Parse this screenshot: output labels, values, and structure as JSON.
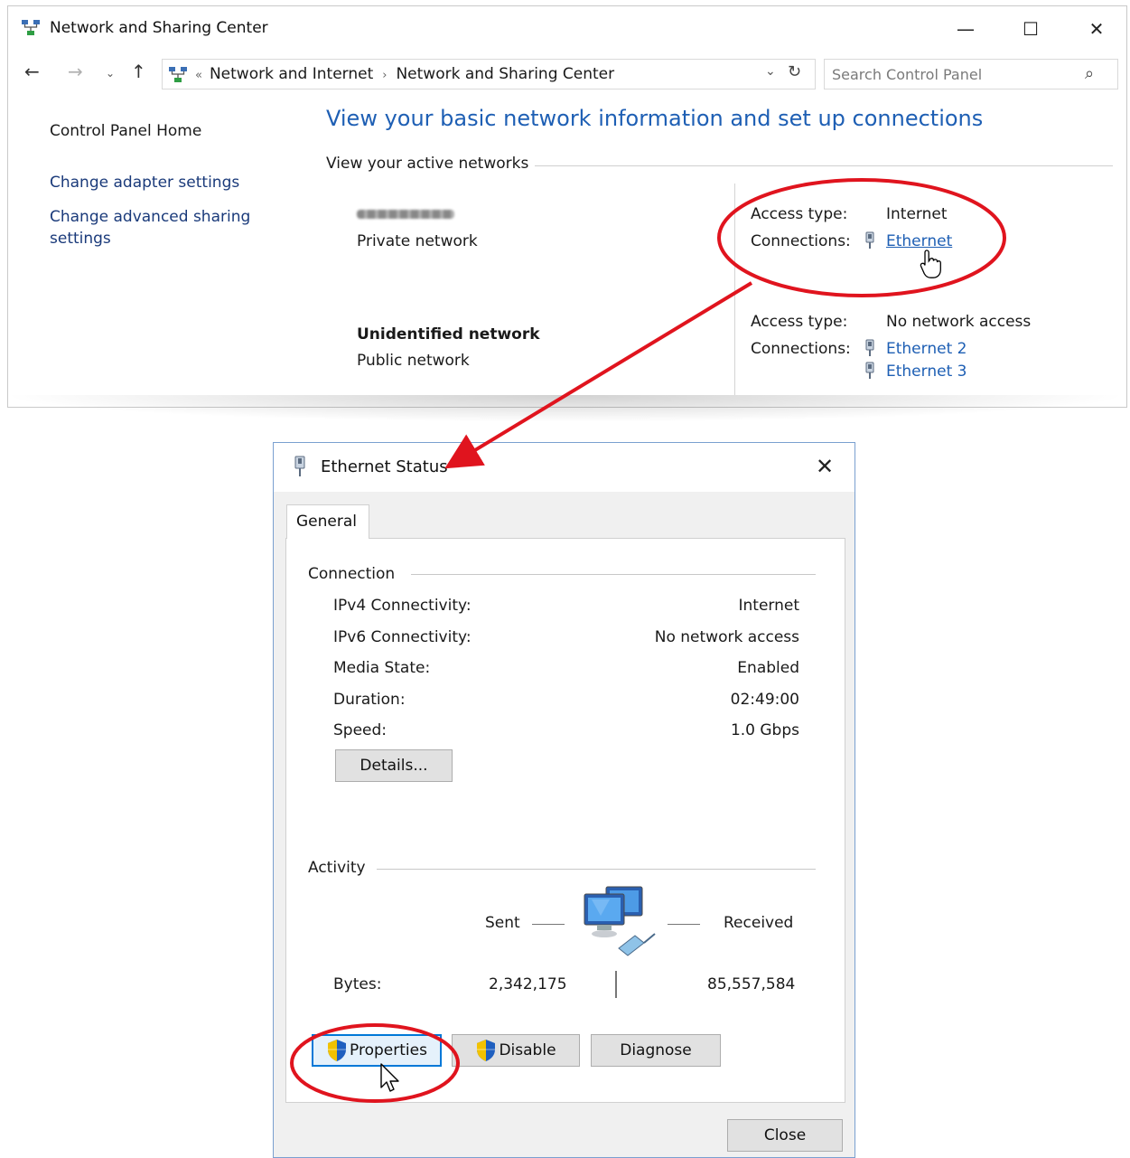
{
  "window": {
    "title": "Network and Sharing Center",
    "controls": {
      "minimize": "—",
      "maximize": "☐",
      "close": "✕"
    }
  },
  "navigation": {
    "back": "←",
    "forward": "→",
    "recent": "⌄",
    "up": "↑",
    "breadcrumb_lead": "«",
    "breadcrumbs": [
      "Network and Internet",
      "Network and Sharing Center"
    ],
    "separator": "›",
    "dropdown": "⌄",
    "refresh": "↻",
    "search_placeholder": "Search Control Panel",
    "search_icon": "⌕"
  },
  "sidebar": {
    "home": "Control Panel Home",
    "items": [
      "Change adapter settings",
      "Change advanced sharing settings"
    ]
  },
  "main": {
    "heading": "View your basic network information and set up connections",
    "active_networks_label": "View your active networks",
    "networks": [
      {
        "name": "",
        "name_blurred": true,
        "type": "Private network",
        "access_label": "Access type:",
        "access_value": "Internet",
        "connections_label": "Connections:",
        "connections": [
          "Ethernet"
        ]
      },
      {
        "name": "Unidentified network",
        "type": "Public network",
        "access_label": "Access type:",
        "access_value": "No network access",
        "connections_label": "Connections:",
        "connections": [
          "Ethernet 2",
          "Ethernet 3"
        ]
      }
    ]
  },
  "dialog": {
    "title": "Ethernet Status",
    "close": "✕",
    "tab": "General",
    "connection_section": "Connection",
    "rows": [
      {
        "label": "IPv4 Connectivity:",
        "value": "Internet"
      },
      {
        "label": "IPv6 Connectivity:",
        "value": "No network access"
      },
      {
        "label": "Media State:",
        "value": "Enabled"
      },
      {
        "label": "Duration:",
        "value": "02:49:00"
      },
      {
        "label": "Speed:",
        "value": "1.0 Gbps"
      }
    ],
    "details_button": "Details...",
    "activity_section": "Activity",
    "sent_label": "Sent",
    "received_label": "Received",
    "bytes_label": "Bytes:",
    "bytes_sent": "2,342,175",
    "bytes_received": "85,557,584",
    "properties_button": "Properties",
    "disable_button": "Disable",
    "diagnose_button": "Diagnose",
    "close_button": "Close"
  },
  "colors": {
    "link": "#1e5fb4",
    "heading": "#1e5fb4",
    "annotation": "#e0141e",
    "focus": "#0078d7"
  }
}
